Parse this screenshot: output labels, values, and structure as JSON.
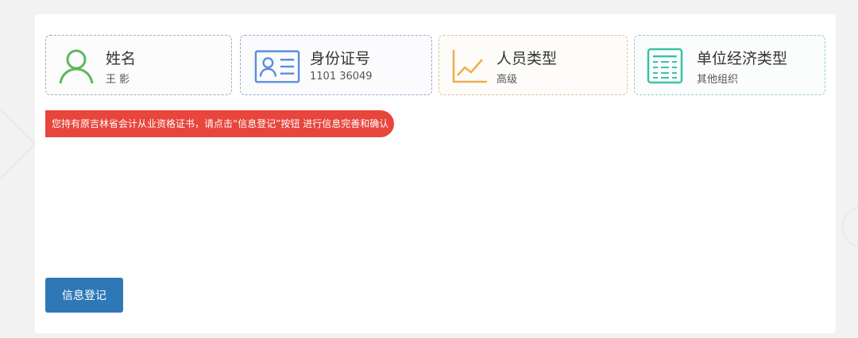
{
  "cards": [
    {
      "title": "姓名",
      "value": "王 影",
      "icon": "user-icon",
      "color": "#5cb85c"
    },
    {
      "title": "身份证号",
      "value": "1101 36049",
      "icon": "id-card-icon",
      "color": "#5b8de0"
    },
    {
      "title": "人员类型",
      "value": "高级",
      "icon": "line-chart-icon",
      "color": "#f0ad4e"
    },
    {
      "title": "单位经济类型",
      "value": "其他组织",
      "icon": "table-icon",
      "color": "#3cc0a8"
    }
  ],
  "alert": {
    "text": "您持有原吉林省会计从业资格证书，请点击“信息登记”按钮 进行信息完善和确认",
    "color": "#e8453c"
  },
  "actions": {
    "register_label": "信息登记"
  }
}
